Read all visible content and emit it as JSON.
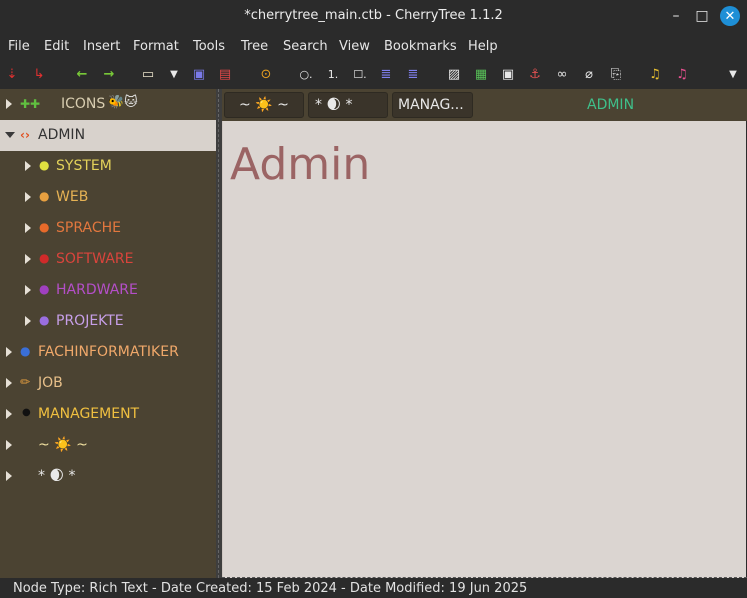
{
  "window": {
    "title": "*cherrytree_main.ctb - CherryTree 1.1.2",
    "controls": {
      "minimize": "–",
      "maximize": "□",
      "close": "✕"
    }
  },
  "menu": [
    "File",
    "Edit",
    "Insert",
    "Format",
    "Tools",
    "Tree",
    "Search",
    "View",
    "Bookmarks",
    "Help"
  ],
  "toolbar": {
    "icons": [
      "add-node-icon",
      "add-subnode-icon",
      "back-icon",
      "forward-icon",
      "open-file-icon",
      "open-dropdown-icon",
      "save-icon",
      "export-icon",
      "find-icon",
      "toggle-bullet-icon",
      "toggle-numbered-icon",
      "toggle-todo-icon",
      "indent-icon",
      "unindent-icon",
      "insert-image-icon",
      "insert-table-icon",
      "insert-codebox-icon",
      "insert-anchor-icon",
      "insert-link-icon",
      "remove-link-icon",
      "insert-file-icon",
      "ct-logo-icon",
      "ct-logo-alt-icon",
      "overflow-icon"
    ]
  },
  "tree": {
    "nodes": [
      {
        "label": "ICONS",
        "prefix_icons": "🧩🧩",
        "suffix": "🐝🐱",
        "color": "#d8cdb0",
        "expanded": false,
        "level": 0
      },
      {
        "label": "ADMIN",
        "prefix_icons": "⟨⟩",
        "color": "#333333",
        "expanded": true,
        "level": 0,
        "selected": true
      },
      {
        "label": "SYSTEM",
        "prefix_icons": "●",
        "icon_color": "#e0e040",
        "color": "#e3d25a",
        "expanded": false,
        "level": 1
      },
      {
        "label": "WEB",
        "prefix_icons": "●",
        "icon_color": "#e8a040",
        "color": "#e6b254",
        "expanded": false,
        "level": 1
      },
      {
        "label": "SPRACHE",
        "prefix_icons": "●",
        "icon_color": "#e86a2a",
        "color": "#e2773e",
        "expanded": false,
        "level": 1
      },
      {
        "label": "SOFTWARE",
        "prefix_icons": "●",
        "icon_color": "#d02a2a",
        "color": "#d9443c",
        "expanded": false,
        "level": 1
      },
      {
        "label": "HARDWARE",
        "prefix_icons": "●",
        "icon_color": "#a040c0",
        "color": "#b44fc8",
        "expanded": false,
        "level": 1
      },
      {
        "label": "PROJEKTE",
        "prefix_icons": "●",
        "icon_color": "#9a6ee0",
        "color": "#c79fe8",
        "expanded": false,
        "level": 1
      },
      {
        "label": "FACHINFORMATIKER",
        "prefix_icons": "●",
        "icon_color": "#3a6fd8",
        "color": "#f0a86a",
        "expanded": false,
        "level": 0
      },
      {
        "label": "JOB",
        "prefix_icons": "✏",
        "icon_color": "#e8a040",
        "color": "#e8c08a",
        "expanded": false,
        "level": 0
      },
      {
        "label": "MANAGEMENT",
        "prefix_icons": "●",
        "icon_color": "#111111",
        "color": "#f0c040",
        "expanded": false,
        "level": 0
      },
      {
        "label": "~ ☀️  ~",
        "prefix_icons": "",
        "color": "#f0e0a0",
        "expanded": false,
        "level": 0
      },
      {
        "label": "*  🌒      *",
        "prefix_icons": "",
        "color": "#e8e8e8",
        "expanded": false,
        "level": 0
      }
    ]
  },
  "breadcrumbs": {
    "items": [
      "~ ☀️  ~",
      "*  🌒      *",
      "MANAG..."
    ],
    "active": "ADMIN"
  },
  "editor": {
    "heading": "Admin"
  },
  "status": {
    "text": "Node Type: Rich Text  -  Date Created: 15 Feb 2024  -  Date Modified: 19 Jun 2025"
  }
}
